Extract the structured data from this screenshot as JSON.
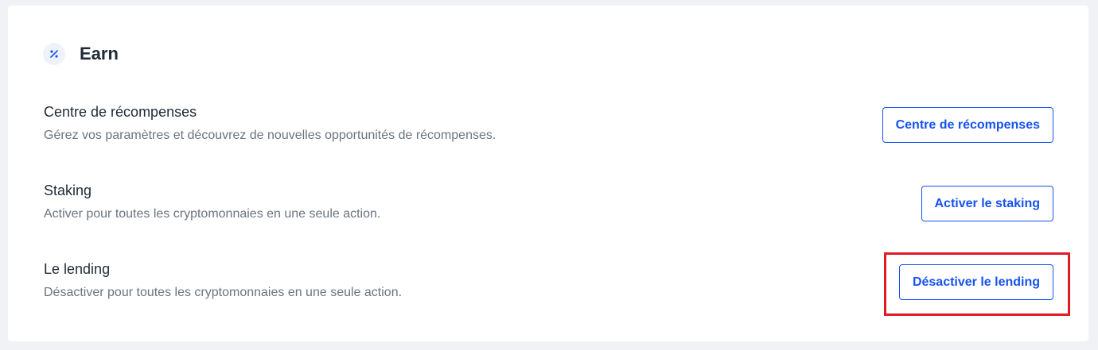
{
  "section": {
    "title": "Earn",
    "icon": "percent-icon"
  },
  "rows": [
    {
      "title": "Centre de récompenses",
      "description": "Gérez vos paramètres et découvrez de nouvelles opportunités de récompenses.",
      "button_label": "Centre de récompenses"
    },
    {
      "title": "Staking",
      "description": "Activer pour toutes les cryptomonnaies en une seule action.",
      "button_label": "Activer le staking"
    },
    {
      "title": "Le lending",
      "description": "Désactiver pour toutes les cryptomonnaies en une seule action.",
      "button_label": "Désactiver le lending"
    }
  ],
  "colors": {
    "accent": "#1652f0",
    "highlight": "#e01b24",
    "title_text": "#1f2a37",
    "description_text": "#6b7480"
  }
}
